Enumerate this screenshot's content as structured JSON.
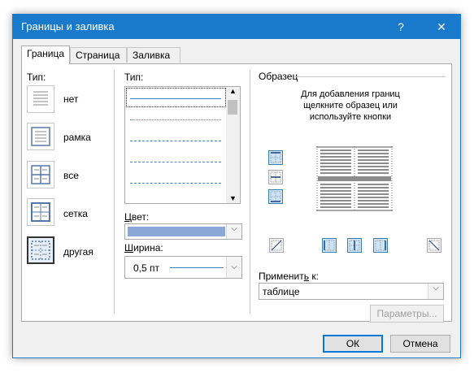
{
  "window": {
    "title": "Границы и заливка",
    "help_button": "?",
    "close_button": "✕"
  },
  "tabs": [
    {
      "label": "Граница",
      "active": true
    },
    {
      "label": "Страница",
      "active": false
    },
    {
      "label": "Заливка",
      "active": false
    }
  ],
  "settings": {
    "label": "Тип:",
    "items": [
      {
        "label": "нет",
        "selected": false
      },
      {
        "label": "рамка",
        "selected": false
      },
      {
        "label": "все",
        "selected": false
      },
      {
        "label": "сетка",
        "selected": false
      },
      {
        "label": "другая",
        "selected": true
      }
    ]
  },
  "style": {
    "label": "Тип:",
    "line_styles": [
      "solid",
      "dotted",
      "dashed-small",
      "dashed",
      "dash-dot"
    ],
    "selected_index": 0
  },
  "color": {
    "label": "Цвет:",
    "value_color": "#8aa7d8"
  },
  "width": {
    "label": "Ширина:",
    "value": "0,5 пт"
  },
  "preview": {
    "label": "Образец",
    "hint": "Для добавления границ щелкните образец или используйте кнопки"
  },
  "apply_to": {
    "label": "Применить к:",
    "value": "таблице"
  },
  "buttons": {
    "options": "Параметры...",
    "ok": "ОК",
    "cancel": "Отмена"
  },
  "colors": {
    "titlebar": "#1979ca",
    "accent": "#0078d7"
  }
}
